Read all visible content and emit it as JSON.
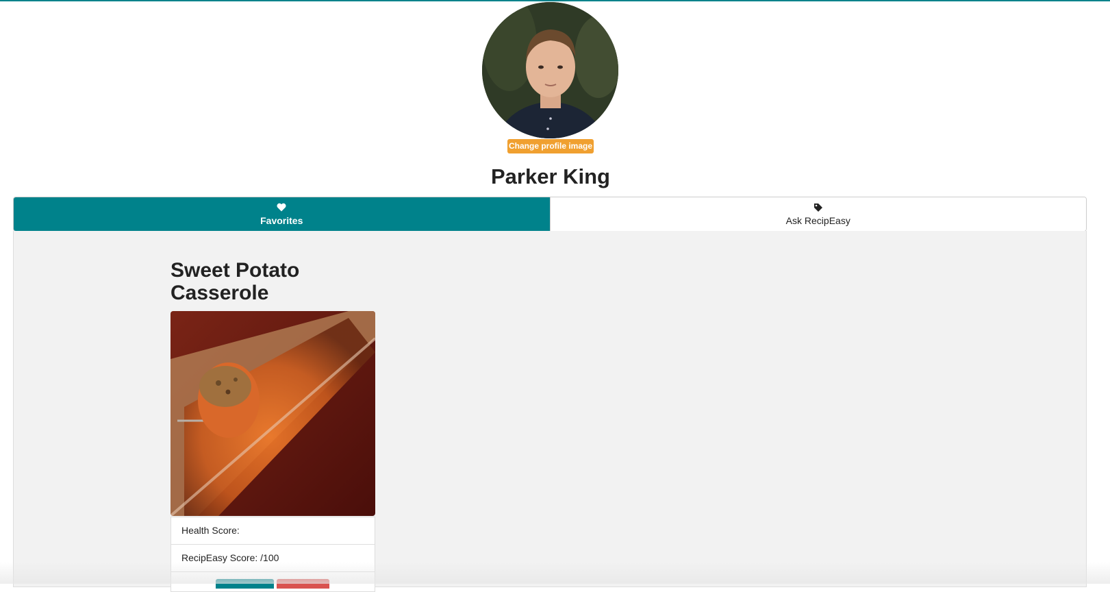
{
  "profile": {
    "name": "Parker King",
    "change_image_label": "Change profile image"
  },
  "tabs": [
    {
      "label": "Favorites",
      "icon": "heart-icon",
      "active": true
    },
    {
      "label": "Ask RecipEasy",
      "icon": "tag-icon",
      "active": false
    }
  ],
  "recipe": {
    "title": "Sweet Potato Casserole",
    "health_score_label": "Health Score:",
    "recipeasy_score_label": "RecipEasy Score: /100"
  },
  "colors": {
    "accent": "#00828b",
    "warning": "#f0a030",
    "danger": "#d9534f",
    "panel_bg": "#f2f2f2"
  }
}
